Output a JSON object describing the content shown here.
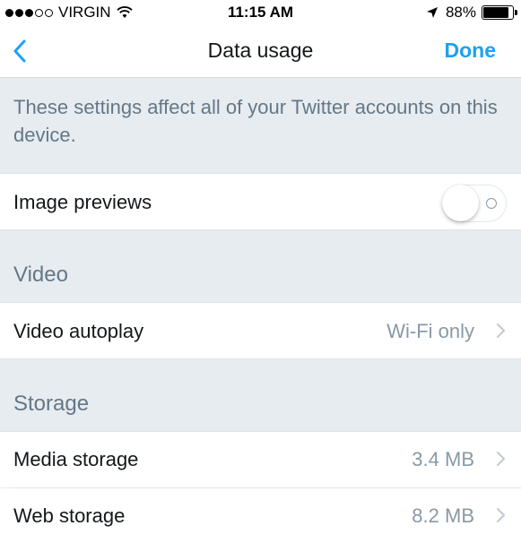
{
  "status_bar": {
    "signal_dots": [
      "full",
      "full",
      "full",
      "empty",
      "empty"
    ],
    "carrier": "VIRGIN",
    "wifi_icon": "wifi-icon",
    "time": "11:15 AM",
    "location_icon": "location-arrow-icon",
    "battery_percent": "88%",
    "battery_level": 0.88
  },
  "nav": {
    "back_icon": "chevron-left-icon",
    "title": "Data usage",
    "done_label": "Done"
  },
  "info": {
    "text": "These settings affect all of your Twitter accounts on this device."
  },
  "image_previews": {
    "label": "Image previews",
    "toggle_on": false
  },
  "video": {
    "header": "Video",
    "autoplay_label": "Video autoplay",
    "autoplay_value": "Wi-Fi only"
  },
  "storage": {
    "header": "Storage",
    "media_label": "Media storage",
    "media_value": "3.4 MB",
    "web_label": "Web storage",
    "web_value": "8.2 MB"
  },
  "colors": {
    "accent": "#1da1f2",
    "background": "#e6ecf0",
    "secondary_text": "#657786",
    "value_text": "#8899a6"
  }
}
